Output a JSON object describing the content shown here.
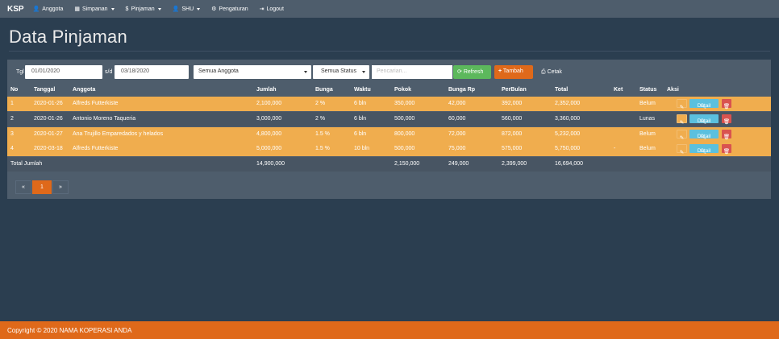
{
  "navbar": {
    "brand": "KSP",
    "items": [
      {
        "label": "Anggota",
        "icon": "user-icon",
        "glyph": "👤",
        "dropdown": false
      },
      {
        "label": "Simpanan",
        "icon": "grid-icon",
        "glyph": "▦",
        "dropdown": true
      },
      {
        "label": "Pinjaman",
        "icon": "dollar-icon",
        "glyph": "$",
        "dropdown": true
      },
      {
        "label": "SHU",
        "icon": "user-icon",
        "glyph": "👤",
        "dropdown": true
      },
      {
        "label": "Pengaturan",
        "icon": "gear-icon",
        "glyph": "⚙",
        "dropdown": false
      },
      {
        "label": "Logout",
        "icon": "logout-icon",
        "glyph": "⇥",
        "dropdown": false
      }
    ]
  },
  "page": {
    "title": "Data Pinjaman"
  },
  "filters": {
    "tgl_label": "Tgl",
    "date_from": "01/01/2020",
    "sd_label": "s/d",
    "date_to": "03/18/2020",
    "anggota_select": "Semua Anggota",
    "status_select": "Semua Status",
    "search_placeholder": "Pencarian...",
    "refresh_label": "Refresh",
    "tambah_label": "Tambah",
    "cetak_label": "Cetak"
  },
  "table": {
    "headers": [
      "No",
      "Tanggal",
      "Anggota",
      "Jumlah",
      "Bunga",
      "Waktu",
      "Pokok",
      "Bunga Rp",
      "PerBulan",
      "Total",
      "Ket",
      "Status",
      "Aksi"
    ],
    "rows": [
      {
        "no": "1",
        "tanggal": "2020-01-26",
        "anggota": "Alfreds Futterkiste",
        "jumlah": "2,100,000",
        "bunga": "2 %",
        "waktu": "6 bln",
        "pokok": "350,000",
        "bunga_rp": "42,000",
        "perbulan": "392,000",
        "total": "2,352,000",
        "ket": "",
        "status": "Belum",
        "style": "orange"
      },
      {
        "no": "2",
        "tanggal": "2020-01-26",
        "anggota": "Antonio Moreno Taqueria",
        "jumlah": "3,000,000",
        "bunga": "2 %",
        "waktu": "6 bln",
        "pokok": "500,000",
        "bunga_rp": "60,000",
        "perbulan": "560,000",
        "total": "3,360,000",
        "ket": "",
        "status": "Lunas",
        "style": "dark"
      },
      {
        "no": "3",
        "tanggal": "2020-01-27",
        "anggota": "Ana Trujillo Emparedados y helados",
        "jumlah": "4,800,000",
        "bunga": "1.5 %",
        "waktu": "6 bln",
        "pokok": "800,000",
        "bunga_rp": "72,000",
        "perbulan": "872,000",
        "total": "5,232,000",
        "ket": "",
        "status": "Belum",
        "style": "orange"
      },
      {
        "no": "4",
        "tanggal": "2020-03-18",
        "anggota": "Alfreds Futterkiste",
        "jumlah": "5,000,000",
        "bunga": "1.5 %",
        "waktu": "10 bln",
        "pokok": "500,000",
        "bunga_rp": "75,000",
        "perbulan": "575,000",
        "total": "5,750,000",
        "ket": "-",
        "status": "Belum",
        "style": "orange"
      }
    ],
    "actions": {
      "detail_label": "Detail"
    },
    "total": {
      "label": "Total Jumlah",
      "jumlah": "14,900,000",
      "pokok": "2,150,000",
      "bunga_rp": "249,000",
      "perbulan": "2,399,000",
      "total": "16,694,000"
    }
  },
  "pagination": {
    "prev": "«",
    "current": "1",
    "next": "»"
  },
  "footer": {
    "text": "Copyright © 2020 NAMA KOPERASI ANDA"
  },
  "colors": {
    "bg": "#2b3e50",
    "panel": "#4e5d6c",
    "orange": "#df691a",
    "warning": "#f0ad4e",
    "success": "#5cb85c",
    "info": "#5bc0de",
    "danger": "#d9534f"
  }
}
